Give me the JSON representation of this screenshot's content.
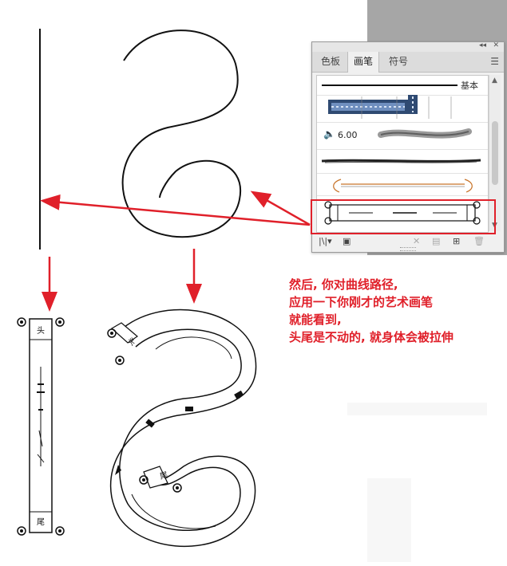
{
  "panel": {
    "tabs": [
      {
        "label": "色板",
        "active": false
      },
      {
        "label": "画笔",
        "active": true
      },
      {
        "label": "符号",
        "active": false
      }
    ],
    "top_controls": {
      "collapse": "◂◂",
      "close": "✕"
    },
    "menu_icon": "hamburger-menu-icon",
    "brushes": [
      {
        "type": "basic-line",
        "label": "基本"
      },
      {
        "type": "pattern-brush"
      },
      {
        "type": "bristle-brush",
        "value": "6.00"
      },
      {
        "type": "charcoal-art-brush"
      },
      {
        "type": "arrow-art-brush"
      },
      {
        "type": "scroll-art-brush",
        "selected": true
      }
    ],
    "selected_highlight_color": "#e0202a",
    "bottom_icons": [
      "brush-libraries-icon",
      "libraries-panel-icon",
      "remove-stroke-icon",
      "brush-options-icon",
      "new-brush-icon",
      "delete-brush-icon"
    ]
  },
  "annotation": {
    "lines": [
      "然后, 你对曲线路径,",
      "应用一下你刚才的艺术画笔",
      "就能看到,",
      "头尾是不动的, 就身体会被拉伸"
    ],
    "color": "#e0202a"
  },
  "scroll_labels": {
    "head": "头",
    "tail": "尾"
  }
}
